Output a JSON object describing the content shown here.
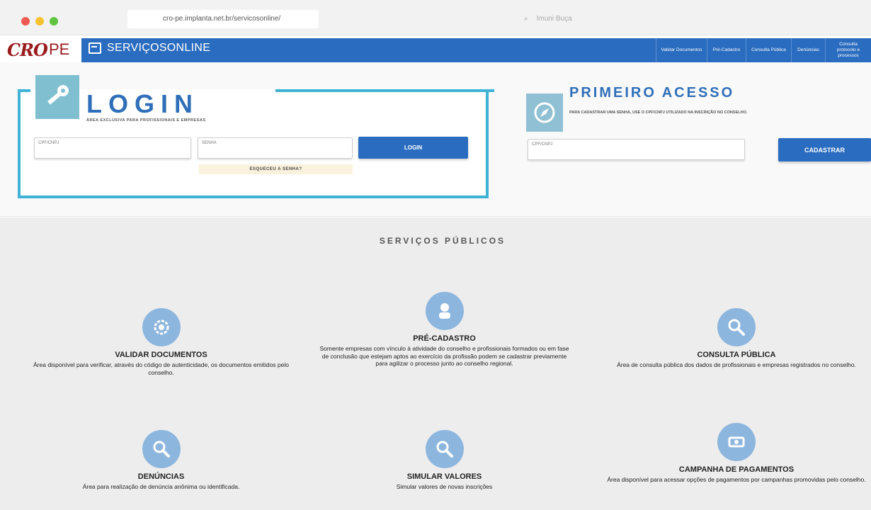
{
  "browser": {
    "url": "cro-pe.implanta.net.br/servicosonline/",
    "search_placeholder": "Imuni Buça"
  },
  "brand": {
    "logo_text": "CRO",
    "region": "PE"
  },
  "nav": {
    "app_title": "SERVIÇOSONLINE",
    "links": [
      "Validar Documentos",
      "Pré-Cadastro",
      "Consulta Pública",
      "Denúncias",
      "Consulta protocolo e processos"
    ]
  },
  "login": {
    "title": "LOGIN",
    "subtitle": "ÁREA EXCLUSIVA PARA PROFISSIONAIS E EMPRESAS",
    "cpf_label": "CPF/CNPJ",
    "senha_label": "SENHA",
    "button": "LOGIN",
    "forgot": "ESQUECEU A SENHA?"
  },
  "primeiro_acesso": {
    "title": "PRIMEIRO ACESSO",
    "subtitle": "PARA CADASTRAR UMA SENHA, USE O CPF/CNPJ UTILIZADO NA INSCRIÇÃO NO CONSELHO.",
    "cpf_label": "CPF/CNPJ",
    "button": "CADASTRAR"
  },
  "services": {
    "title": "SERVIÇOS PÚBLICOS",
    "items": [
      {
        "title": "VALIDAR DOCUMENTOS",
        "desc": "Área disponível para verificar, através do código de autenticidade, os documentos emitidos pelo conselho."
      },
      {
        "title": "PRÉ-CADASTRO",
        "desc": "Somente empresas com vínculo à atividade do conselho e profissionais formados ou em fase de conclusão que estejam aptos ao exercício da profissão podem se cadastrar previamente para agilizar o processo junto ao conselho regional."
      },
      {
        "title": "CONSULTA PÚBLICA",
        "desc": "Área de consulta pública dos dados de profissionais e empresas registrados no conselho."
      },
      {
        "title": "DENÚNCIAS",
        "desc": "Área para realização de denúncia anônima ou identificada."
      },
      {
        "title": "SIMULAR VALORES",
        "desc": "Simular valores de novas inscrições"
      },
      {
        "title": "CAMPANHA DE PAGAMENTOS",
        "desc": "Área disponível para acessar opções de pagamentos por campanhas promovidas pelo conselho."
      }
    ]
  },
  "colors": {
    "primary": "#2a6cbf",
    "accent": "#3fb3d6",
    "brand": "#9a1b1e",
    "icon_circle": "#8db6de"
  }
}
